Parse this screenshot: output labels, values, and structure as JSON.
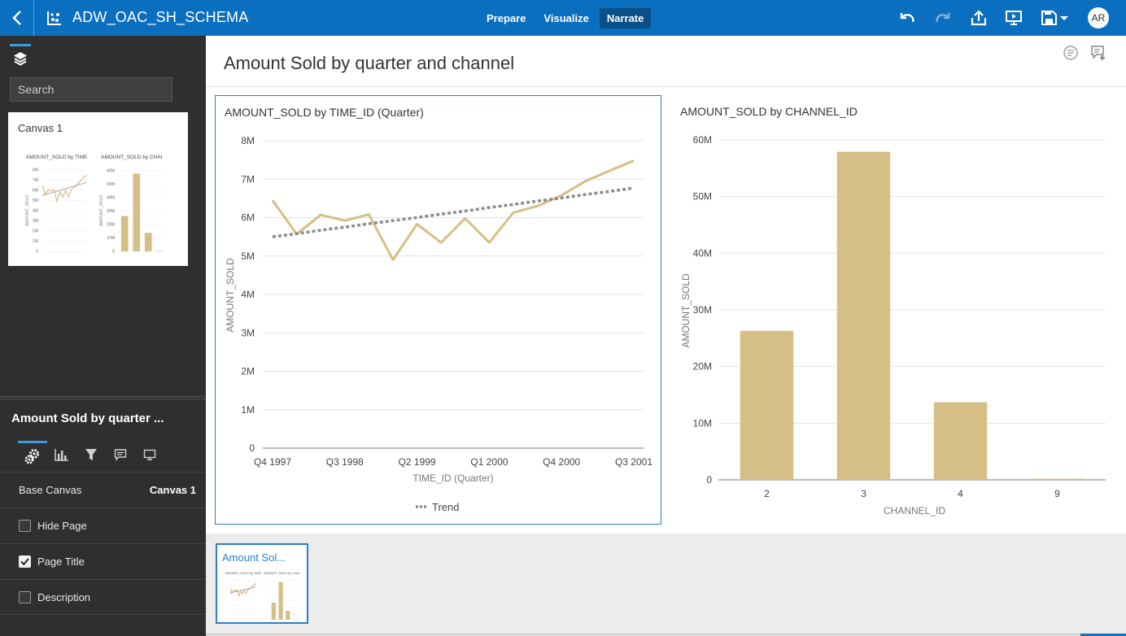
{
  "header": {
    "title": "ADW_OAC_SH_SCHEMA",
    "tabs": [
      {
        "label": "Prepare",
        "active": false
      },
      {
        "label": "Visualize",
        "active": false
      },
      {
        "label": "Narrate",
        "active": true
      }
    ],
    "avatar_initials": "AR",
    "accent_color": "#0b6fbf"
  },
  "sidebar": {
    "search": {
      "placeholder": "Search",
      "value": ""
    },
    "canvas_thumb": {
      "label": "Canvas 1",
      "mini_titles": [
        "AMOUNT_SOLD by TIME",
        "AMOUNT_SOLD by CHAI"
      ],
      "mini_ylabel": "AMOUNT_SOLD",
      "mini_line_ticks": [
        "8M",
        "7M",
        "6M",
        "5M",
        "4M",
        "3M",
        "2M",
        "1M",
        "0"
      ],
      "mini_bar_ticks": [
        "60M",
        "50M",
        "40M",
        "30M",
        "20M",
        "10M",
        "0"
      ]
    },
    "properties": {
      "title": "Amount Sold by quarter ...",
      "rows": [
        {
          "label": "Base Canvas",
          "value": "Canvas 1"
        },
        {
          "label": "Hide Page",
          "checked": false
        },
        {
          "label": "Page Title",
          "checked": true
        },
        {
          "label": "Description",
          "checked": false
        }
      ]
    }
  },
  "main": {
    "page_title": "Amount Sold by quarter and channel",
    "page_thumb_label": "Amount Sol..."
  },
  "chart_data": [
    {
      "type": "line",
      "title": "AMOUNT_SOLD by TIME_ID (Quarter)",
      "xlabel": "TIME_ID (Quarter)",
      "ylabel": "AMOUNT_SOLD",
      "x_ticks": [
        "Q4 1997",
        "Q3 1998",
        "Q2 1999",
        "Q1 2000",
        "Q4 2000",
        "Q3 2001"
      ],
      "y_ticks": [
        "8M",
        "7M",
        "6M",
        "5M",
        "4M",
        "3M",
        "2M",
        "1M",
        "0"
      ],
      "ylim": [
        0,
        8
      ],
      "y_unit": "M",
      "categories": [
        "Q4 1997",
        "Q1 1998",
        "Q2 1998",
        "Q3 1998",
        "Q4 1998",
        "Q1 1999",
        "Q2 1999",
        "Q3 1999",
        "Q4 1999",
        "Q1 2000",
        "Q2 2000",
        "Q3 2000",
        "Q4 2000",
        "Q1 2001",
        "Q2 2001",
        "Q3 2001"
      ],
      "series": [
        {
          "values": [
            6.45,
            5.57,
            6.07,
            5.92,
            6.08,
            4.9,
            5.83,
            5.35,
            5.98,
            5.35,
            6.13,
            6.3,
            6.58,
            6.95,
            7.22,
            7.48
          ],
          "color": "#d6bf86"
        },
        {
          "name": "Trend",
          "values": [
            5.5,
            5.58,
            5.67,
            5.75,
            5.84,
            5.92,
            6.0,
            6.09,
            6.17,
            6.26,
            6.34,
            6.43,
            6.51,
            6.6,
            6.68,
            6.77
          ],
          "color": "#8c8c8c",
          "dashed": true
        }
      ],
      "legend": [
        "Trend"
      ],
      "legend_position": "bottom",
      "grid": true
    },
    {
      "type": "bar",
      "title": "AMOUNT_SOLD by CHANNEL_ID",
      "xlabel": "CHANNEL_ID",
      "ylabel": "AMOUNT_SOLD",
      "categories": [
        "2",
        "3",
        "4",
        "9"
      ],
      "values": [
        26.3,
        57.9,
        13.7,
        0.2
      ],
      "y_ticks": [
        "60M",
        "50M",
        "40M",
        "30M",
        "20M",
        "10M",
        "0"
      ],
      "ylim": [
        0,
        60
      ],
      "y_unit": "M",
      "color": "#d6bf86",
      "grid": true
    }
  ]
}
